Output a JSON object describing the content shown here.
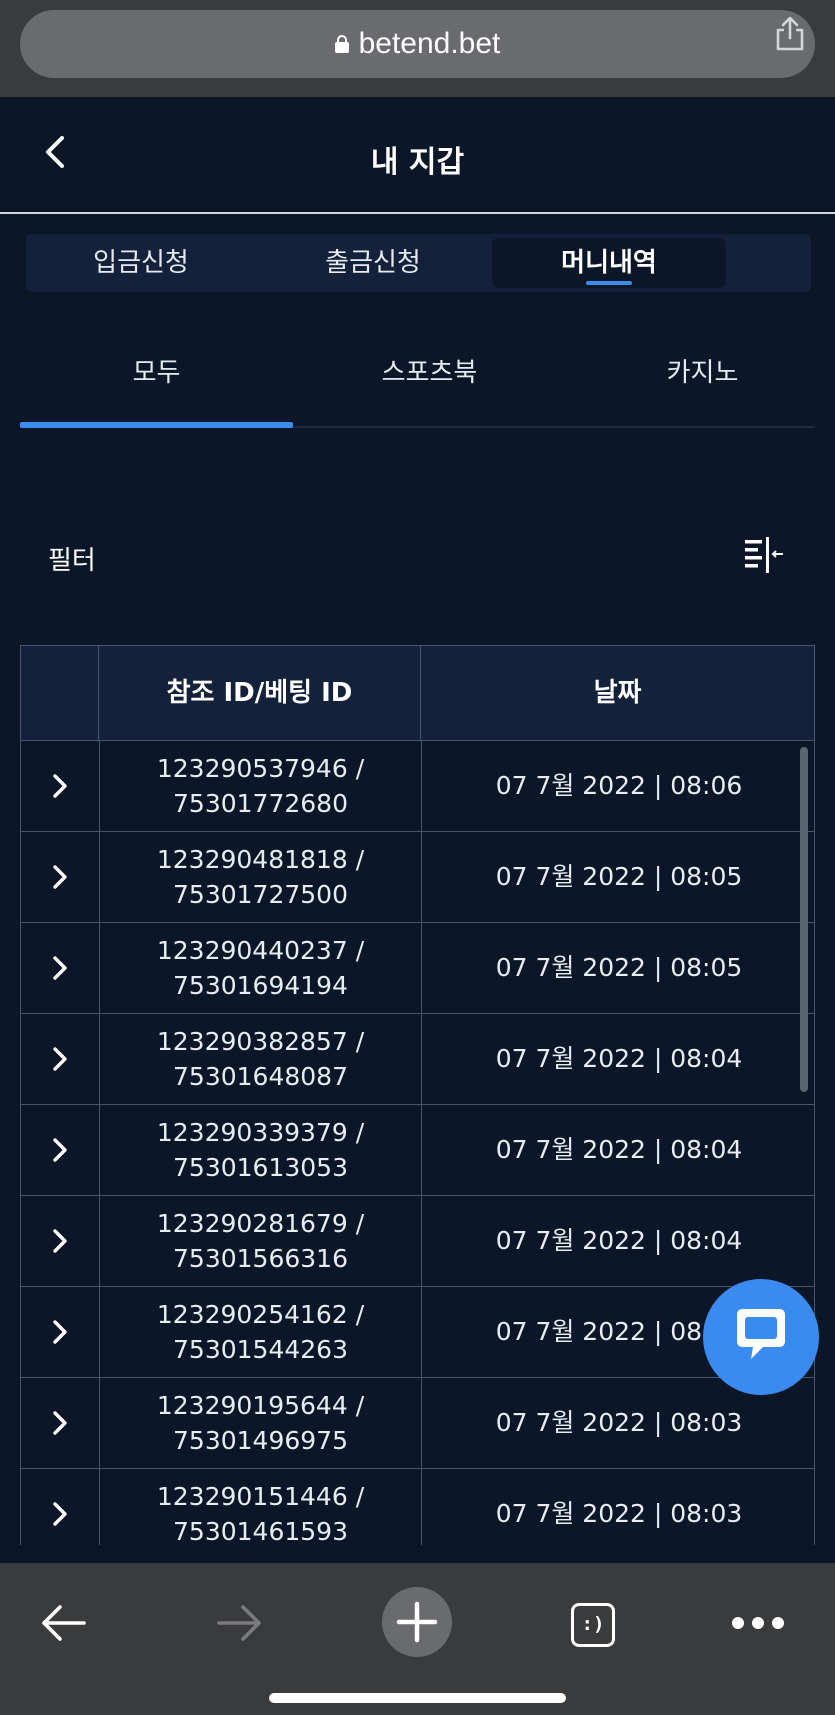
{
  "browser": {
    "url": "betend.bet"
  },
  "header": {
    "title": "내 지갑"
  },
  "tabs": [
    {
      "label": "입금신청",
      "active": false
    },
    {
      "label": "출금신청",
      "active": false
    },
    {
      "label": "머니내역",
      "active": true
    }
  ],
  "subtabs": [
    {
      "label": "모두",
      "active": true
    },
    {
      "label": "스포츠북",
      "active": false
    },
    {
      "label": "카지노",
      "active": false
    }
  ],
  "filter": {
    "label": "필터"
  },
  "table": {
    "headers": [
      "",
      "참조 ID/베팅 ID",
      "날짜"
    ],
    "rows": [
      {
        "ref_id": "123290537946 /",
        "bet_id": "75301772680",
        "date": "07 7월 2022 | 08:06"
      },
      {
        "ref_id": "123290481818 /",
        "bet_id": "75301727500",
        "date": "07 7월 2022 | 08:05"
      },
      {
        "ref_id": "123290440237 /",
        "bet_id": "75301694194",
        "date": "07 7월 2022 | 08:05"
      },
      {
        "ref_id": "123290382857 /",
        "bet_id": "75301648087",
        "date": "07 7월 2022 | 08:04"
      },
      {
        "ref_id": "123290339379 /",
        "bet_id": "75301613053",
        "date": "07 7월 2022 | 08:04"
      },
      {
        "ref_id": "123290281679 /",
        "bet_id": "75301566316",
        "date": "07 7월 2022 | 08:04"
      },
      {
        "ref_id": "123290254162 /",
        "bet_id": "75301544263",
        "date": "07 7월 2022 | 08:04"
      },
      {
        "ref_id": "123290195644 /",
        "bet_id": "75301496975",
        "date": "07 7월 2022 | 08:03"
      },
      {
        "ref_id": "123290151446 /",
        "bet_id": "75301461593",
        "date": "07 7월 2022 | 08:03"
      }
    ]
  },
  "browser_toolbar": {
    "tabs_icon_text": ":)"
  },
  "colors": {
    "background": "#0b1728",
    "accent": "#3b8cf0",
    "chat": "#3a8af0",
    "header_row": "#13223a"
  }
}
